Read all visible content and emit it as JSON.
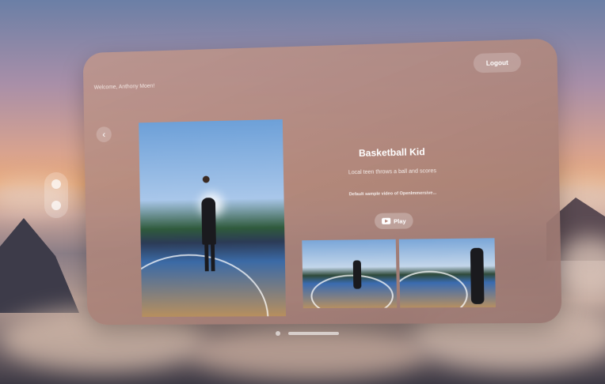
{
  "header": {
    "welcome_text": "Welcome, Anthony Moen!",
    "logout_label": "Logout"
  },
  "nav": {
    "back_icon": "chevron-left-icon"
  },
  "video": {
    "title": "Basketball Kid",
    "subtitle": "Local teen throws a ball and scores",
    "description": "Default sample video of OpenImmersive...",
    "play_label": "Play",
    "play_icon": "play-icon"
  },
  "colors": {
    "window": "#b58f87",
    "accent": "#ffffff"
  }
}
